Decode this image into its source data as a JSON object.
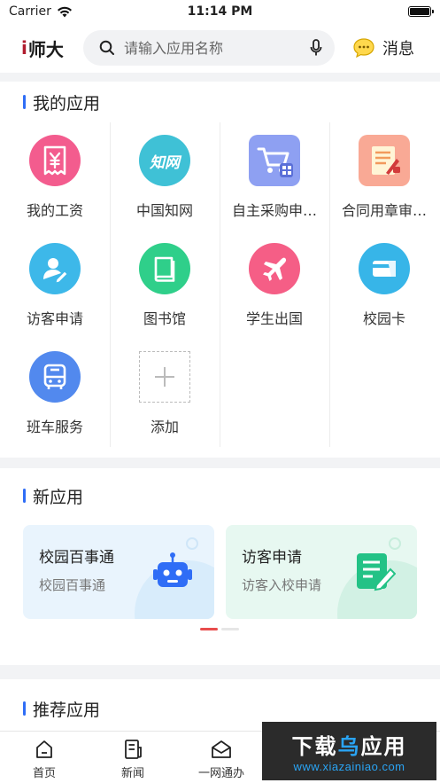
{
  "status": {
    "carrier": "Carrier",
    "time": "11:14 PM"
  },
  "header": {
    "logo": "师大",
    "search_placeholder": "请输入应用名称",
    "message_label": "消息"
  },
  "my_apps": {
    "title": "我的应用",
    "items": [
      {
        "label": "我的工资",
        "icon": "yen-icon",
        "color": "#f35c8e"
      },
      {
        "label": "中国知网",
        "icon": "cnki-icon",
        "color": "#3fc1d6"
      },
      {
        "label": "自主采购申…",
        "icon": "cart-icon",
        "color": "#8ea0f2"
      },
      {
        "label": "合同用章审…",
        "icon": "contract-stamp-icon",
        "color": "#f9a995"
      },
      {
        "label": "访客申请",
        "icon": "visitor-icon",
        "color": "#3db8e9"
      },
      {
        "label": "图书馆",
        "icon": "book-icon",
        "color": "#2fcf8a"
      },
      {
        "label": "学生出国",
        "icon": "plane-icon",
        "color": "#f55e86"
      },
      {
        "label": "校园卡",
        "icon": "card-icon",
        "color": "#37b5e8"
      },
      {
        "label": "班车服务",
        "icon": "bus-icon",
        "color": "#5289ee"
      },
      {
        "label": "添加",
        "icon": "add-icon",
        "color": "#bbbbbb"
      }
    ]
  },
  "new_apps": {
    "title": "新应用",
    "cards": [
      {
        "title": "校园百事通",
        "subtitle": "校园百事通",
        "icon": "robot-icon",
        "color": "#e9f4fd"
      },
      {
        "title": "访客申请",
        "subtitle": "访客入校申请",
        "icon": "note-edit-icon",
        "color": "#e7f8f1"
      }
    ],
    "page_count": 2,
    "active_page": 1
  },
  "recommended": {
    "title": "推荐应用"
  },
  "tabbar": {
    "items": [
      {
        "label": "首页"
      },
      {
        "label": "新闻"
      },
      {
        "label": "一网通办"
      }
    ]
  },
  "watermark": {
    "main_a": "下载",
    "main_b": "乌",
    "main_c": "应用",
    "sub": "www.xiazainiao.com"
  }
}
